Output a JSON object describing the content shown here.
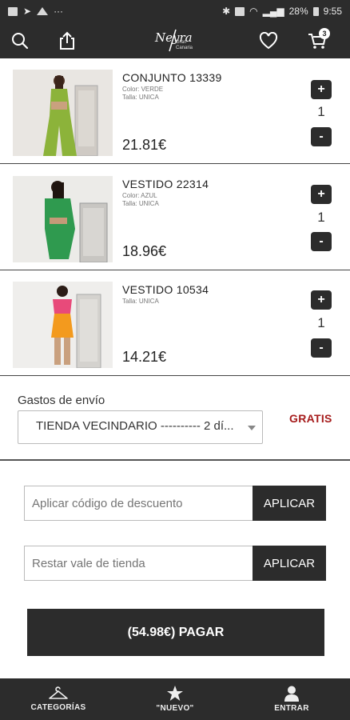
{
  "status_bar": {
    "battery": "28%",
    "time": "9:55"
  },
  "header": {
    "logo_script": "Neyra",
    "logo_sub": "Gran\nCanaria",
    "cart_count": "3"
  },
  "cart": {
    "items": [
      {
        "name": "CONJUNTO 13339",
        "color": "Color: VERDE",
        "size": "Talla: UNICA",
        "price": "21.81€",
        "qty": "1"
      },
      {
        "name": "VESTIDO 22314",
        "color": "Color: AZUL",
        "size": "Talla: UNICA",
        "price": "18.96€",
        "qty": "1"
      },
      {
        "name": "VESTIDO 10534",
        "size": "Talla: UNICA",
        "price": "14.21€",
        "qty": "1"
      }
    ],
    "plus_symbol": "+",
    "minus_symbol": "-"
  },
  "shipping": {
    "label": "Gastos de envío",
    "selected": "TIENDA VECINDARIO ---------- 2 dí...",
    "cost": "GRATIS"
  },
  "discount": {
    "placeholder": "Aplicar código de descuento",
    "button": "APLICAR"
  },
  "voucher": {
    "placeholder": "Restar vale de tienda",
    "button": "APLICAR"
  },
  "pay_button": "(54.98€) PAGAR",
  "bottom_nav": [
    {
      "label": "CATEGORÍAS",
      "icon": "hanger-icon"
    },
    {
      "label": "\"NUEVO\"",
      "icon": "star-icon"
    },
    {
      "label": "ENTRAR",
      "icon": "user-icon"
    }
  ],
  "colors": {
    "dark": "#2c2c2c",
    "gratis": "#a61c1c"
  }
}
